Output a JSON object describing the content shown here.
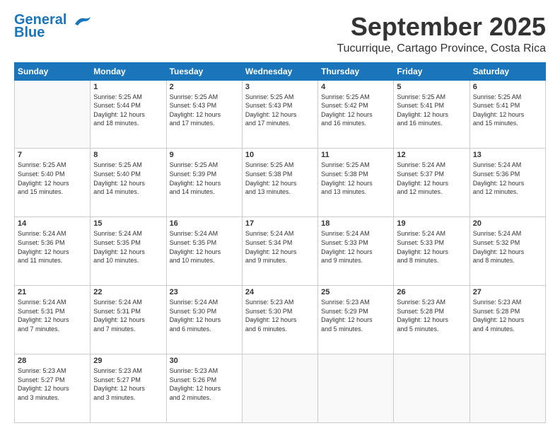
{
  "header": {
    "logo_line1": "General",
    "logo_line2": "Blue",
    "month": "September 2025",
    "location": "Tucurrique, Cartago Province, Costa Rica"
  },
  "days_of_week": [
    "Sunday",
    "Monday",
    "Tuesday",
    "Wednesday",
    "Thursday",
    "Friday",
    "Saturday"
  ],
  "weeks": [
    [
      {
        "num": "",
        "info": ""
      },
      {
        "num": "1",
        "info": "Sunrise: 5:25 AM\nSunset: 5:44 PM\nDaylight: 12 hours\nand 18 minutes."
      },
      {
        "num": "2",
        "info": "Sunrise: 5:25 AM\nSunset: 5:43 PM\nDaylight: 12 hours\nand 17 minutes."
      },
      {
        "num": "3",
        "info": "Sunrise: 5:25 AM\nSunset: 5:43 PM\nDaylight: 12 hours\nand 17 minutes."
      },
      {
        "num": "4",
        "info": "Sunrise: 5:25 AM\nSunset: 5:42 PM\nDaylight: 12 hours\nand 16 minutes."
      },
      {
        "num": "5",
        "info": "Sunrise: 5:25 AM\nSunset: 5:41 PM\nDaylight: 12 hours\nand 16 minutes."
      },
      {
        "num": "6",
        "info": "Sunrise: 5:25 AM\nSunset: 5:41 PM\nDaylight: 12 hours\nand 15 minutes."
      }
    ],
    [
      {
        "num": "7",
        "info": "Sunrise: 5:25 AM\nSunset: 5:40 PM\nDaylight: 12 hours\nand 15 minutes."
      },
      {
        "num": "8",
        "info": "Sunrise: 5:25 AM\nSunset: 5:40 PM\nDaylight: 12 hours\nand 14 minutes."
      },
      {
        "num": "9",
        "info": "Sunrise: 5:25 AM\nSunset: 5:39 PM\nDaylight: 12 hours\nand 14 minutes."
      },
      {
        "num": "10",
        "info": "Sunrise: 5:25 AM\nSunset: 5:38 PM\nDaylight: 12 hours\nand 13 minutes."
      },
      {
        "num": "11",
        "info": "Sunrise: 5:25 AM\nSunset: 5:38 PM\nDaylight: 12 hours\nand 13 minutes."
      },
      {
        "num": "12",
        "info": "Sunrise: 5:24 AM\nSunset: 5:37 PM\nDaylight: 12 hours\nand 12 minutes."
      },
      {
        "num": "13",
        "info": "Sunrise: 5:24 AM\nSunset: 5:36 PM\nDaylight: 12 hours\nand 12 minutes."
      }
    ],
    [
      {
        "num": "14",
        "info": "Sunrise: 5:24 AM\nSunset: 5:36 PM\nDaylight: 12 hours\nand 11 minutes."
      },
      {
        "num": "15",
        "info": "Sunrise: 5:24 AM\nSunset: 5:35 PM\nDaylight: 12 hours\nand 10 minutes."
      },
      {
        "num": "16",
        "info": "Sunrise: 5:24 AM\nSunset: 5:35 PM\nDaylight: 12 hours\nand 10 minutes."
      },
      {
        "num": "17",
        "info": "Sunrise: 5:24 AM\nSunset: 5:34 PM\nDaylight: 12 hours\nand 9 minutes."
      },
      {
        "num": "18",
        "info": "Sunrise: 5:24 AM\nSunset: 5:33 PM\nDaylight: 12 hours\nand 9 minutes."
      },
      {
        "num": "19",
        "info": "Sunrise: 5:24 AM\nSunset: 5:33 PM\nDaylight: 12 hours\nand 8 minutes."
      },
      {
        "num": "20",
        "info": "Sunrise: 5:24 AM\nSunset: 5:32 PM\nDaylight: 12 hours\nand 8 minutes."
      }
    ],
    [
      {
        "num": "21",
        "info": "Sunrise: 5:24 AM\nSunset: 5:31 PM\nDaylight: 12 hours\nand 7 minutes."
      },
      {
        "num": "22",
        "info": "Sunrise: 5:24 AM\nSunset: 5:31 PM\nDaylight: 12 hours\nand 7 minutes."
      },
      {
        "num": "23",
        "info": "Sunrise: 5:24 AM\nSunset: 5:30 PM\nDaylight: 12 hours\nand 6 minutes."
      },
      {
        "num": "24",
        "info": "Sunrise: 5:23 AM\nSunset: 5:30 PM\nDaylight: 12 hours\nand 6 minutes."
      },
      {
        "num": "25",
        "info": "Sunrise: 5:23 AM\nSunset: 5:29 PM\nDaylight: 12 hours\nand 5 minutes."
      },
      {
        "num": "26",
        "info": "Sunrise: 5:23 AM\nSunset: 5:28 PM\nDaylight: 12 hours\nand 5 minutes."
      },
      {
        "num": "27",
        "info": "Sunrise: 5:23 AM\nSunset: 5:28 PM\nDaylight: 12 hours\nand 4 minutes."
      }
    ],
    [
      {
        "num": "28",
        "info": "Sunrise: 5:23 AM\nSunset: 5:27 PM\nDaylight: 12 hours\nand 3 minutes."
      },
      {
        "num": "29",
        "info": "Sunrise: 5:23 AM\nSunset: 5:27 PM\nDaylight: 12 hours\nand 3 minutes."
      },
      {
        "num": "30",
        "info": "Sunrise: 5:23 AM\nSunset: 5:26 PM\nDaylight: 12 hours\nand 2 minutes."
      },
      {
        "num": "",
        "info": ""
      },
      {
        "num": "",
        "info": ""
      },
      {
        "num": "",
        "info": ""
      },
      {
        "num": "",
        "info": ""
      }
    ]
  ]
}
